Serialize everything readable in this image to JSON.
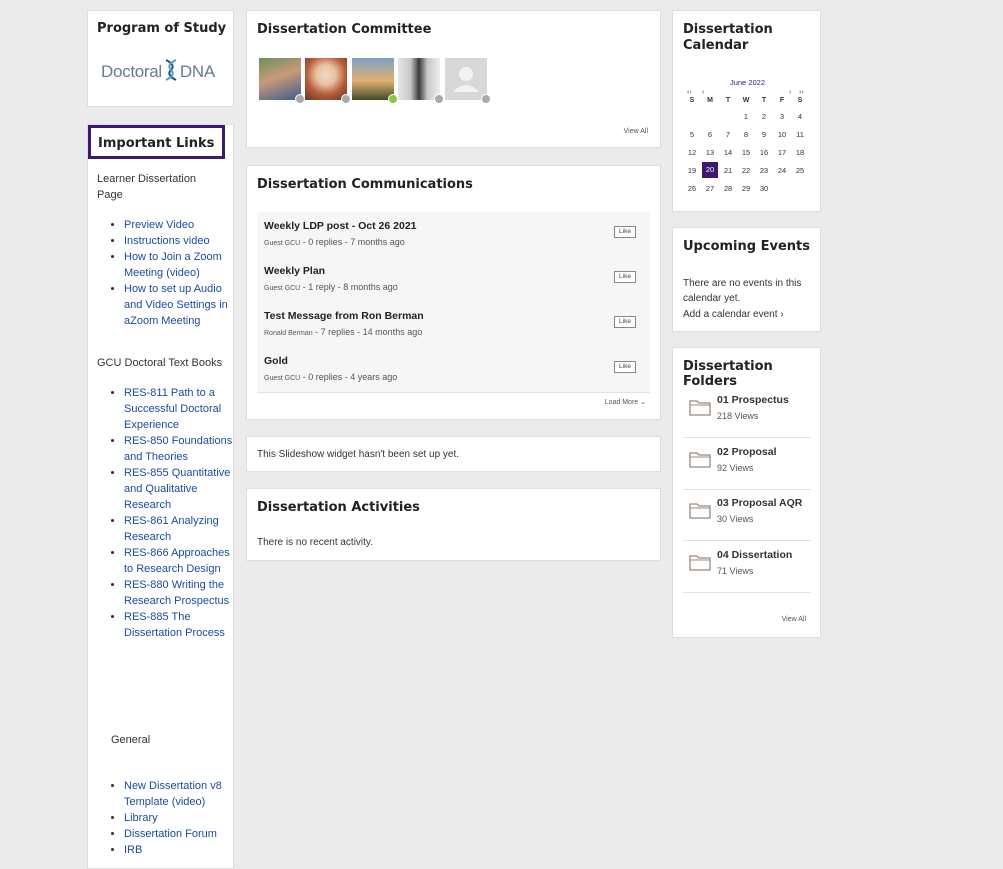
{
  "program_of_study": {
    "title": "Program of Study",
    "logo_text_left": "Doctoral",
    "logo_text_right": "DNA"
  },
  "important_links": {
    "title": "Important Links",
    "section1_label": "Learner Dissertation Page",
    "section1_items": [
      "Preview Video",
      "Instructions video",
      "How to Join a Zoom Meeting (video)",
      "How to set up Audio and Video Settings in aZoom Meeting"
    ],
    "section2_label": "GCU Doctoral Text Books",
    "section2_items": [
      "RES-811 Path to a Successful Doctoral Experience",
      "RES-850  Foundations and Theories",
      "RES-855  Quantitative and Qualitative Research",
      "RES-861 Analyzing Research",
      "RES-866  Approaches to Research Design",
      "RES-880  Writing the Research Prospectus",
      "RES-885  The Dissertation Process"
    ],
    "section3_label": "General",
    "section3_items": [
      "New Dissertation v8 Template (video)",
      "Library",
      "Dissertation Forum",
      " IRB"
    ]
  },
  "committee": {
    "title": "Dissertation Committee",
    "view_all": "View All",
    "members": [
      {
        "status": "offline"
      },
      {
        "status": "offline"
      },
      {
        "status": "online"
      },
      {
        "status": "offline"
      },
      {
        "status": "offline"
      }
    ]
  },
  "communications": {
    "title": "Dissertation Communications",
    "load_more": "Load More",
    "like_label": "Like",
    "posts": [
      {
        "title": "Weekly LDP post - Oct 26 2021",
        "author": "Guest GCU",
        "replies": "0 replies",
        "age": "7 months ago"
      },
      {
        "title": "Weekly Plan",
        "author": "Guest GCU",
        "replies": "1 reply",
        "age": "8 months ago"
      },
      {
        "title": "Test Message from Ron Berman",
        "author": "Ronald Berman",
        "replies": "7 replies",
        "age": "14 months ago"
      },
      {
        "title": "Gold",
        "author": "Guest GCU",
        "replies": "0 replies",
        "age": "4 years ago"
      }
    ]
  },
  "slideshow": {
    "message": "This Slideshow widget hasn't been set up yet."
  },
  "activities": {
    "title": "Dissertation Activities",
    "message": "There is no recent activity."
  },
  "calendar": {
    "title": "Dissertation Calendar",
    "month": "June 2022",
    "prev_year": "‹‹",
    "prev_month": "‹",
    "next_month": "›",
    "next_year": "››",
    "weekdays": [
      "S",
      "M",
      "T",
      "W",
      "T",
      "F",
      "S"
    ],
    "weeks": [
      [
        "",
        "",
        "",
        "1",
        "2",
        "3",
        "4"
      ],
      [
        "5",
        "6",
        "7",
        "8",
        "9",
        "10",
        "11"
      ],
      [
        "12",
        "13",
        "14",
        "15",
        "16",
        "17",
        "18"
      ],
      [
        "19",
        "20",
        "21",
        "22",
        "23",
        "24",
        "25"
      ],
      [
        "26",
        "27",
        "28",
        "29",
        "30",
        "",
        ""
      ]
    ],
    "today": "20",
    "accent": "#3c1873"
  },
  "events": {
    "title": "Upcoming Events",
    "message": "There are no events in this calendar yet.",
    "add_link": "Add a calendar event ›"
  },
  "folders": {
    "title": "Dissertation Folders",
    "view_all": "View All",
    "items": [
      {
        "name": "01 Prospectus",
        "views": "218 Views"
      },
      {
        "name": "02 Proposal",
        "views": "92 Views"
      },
      {
        "name": "03 Proposal AQR",
        "views": "30 Views"
      },
      {
        "name": "04 Dissertation",
        "views": "71 Views"
      }
    ]
  }
}
